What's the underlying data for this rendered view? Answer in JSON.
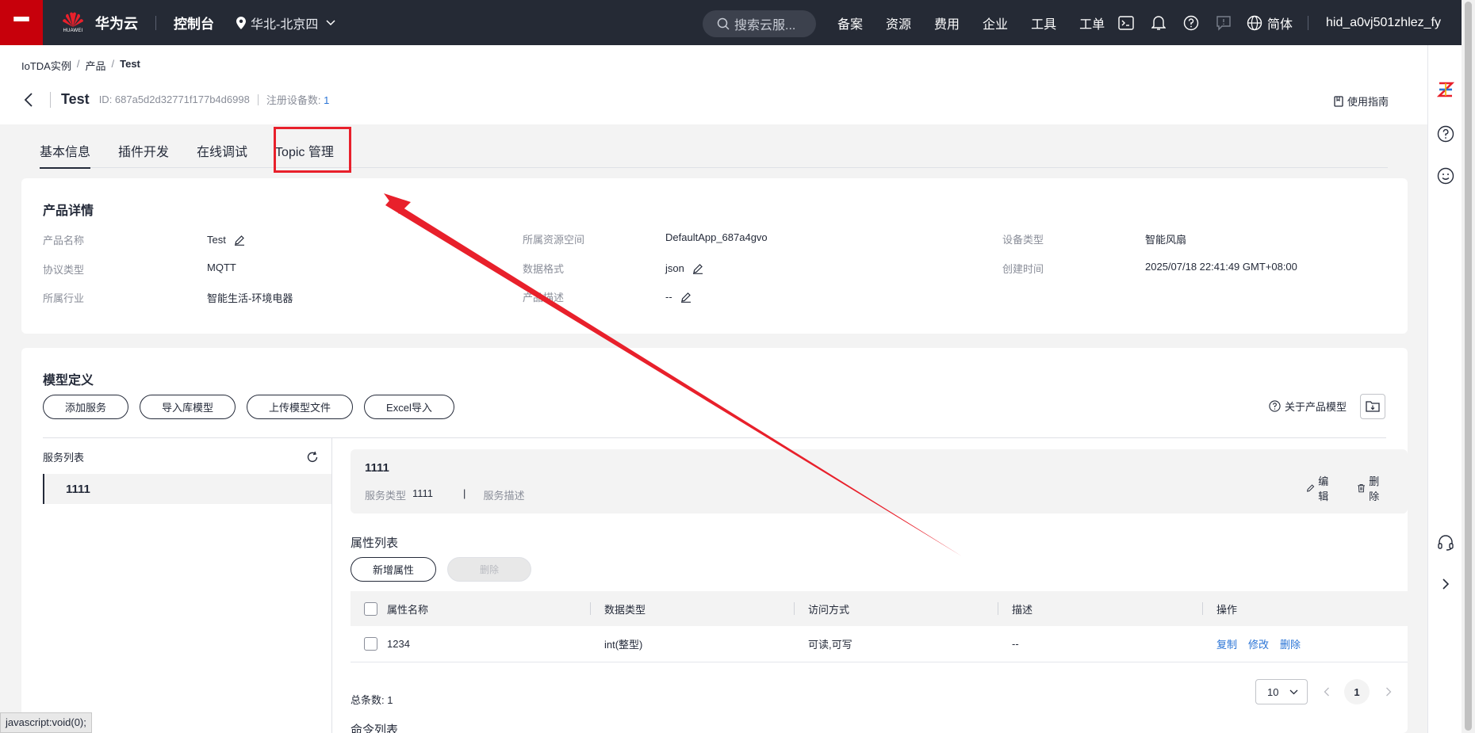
{
  "topbar": {
    "brand": "华为云",
    "brand_small": "HUAWEI",
    "console": "控制台",
    "region": "华北-北京四",
    "search_placeholder": "搜索云服...",
    "nav": [
      "备案",
      "资源",
      "费用",
      "企业",
      "工具",
      "工单"
    ],
    "lang": "简体",
    "user": "hid_a0vj501zhlez_fy"
  },
  "breadcrumb": {
    "items": [
      "IoTDA实例",
      "产品"
    ],
    "current": "Test"
  },
  "header": {
    "title": "Test",
    "id_text": "ID: 687a5d2d32771f177b4d6998",
    "reg_label": "注册设备数:",
    "reg_count": "1",
    "guide": "使用指南"
  },
  "tabs": [
    "基本信息",
    "插件开发",
    "在线调试",
    "Topic 管理"
  ],
  "details": {
    "title": "产品详情",
    "fields": [
      {
        "k": "产品名称",
        "v": "Test"
      },
      {
        "k": "协议类型",
        "v": "MQTT"
      },
      {
        "k": "所属行业",
        "v": "智能生活-环境电器"
      },
      {
        "k": "所属资源空间",
        "v": "DefaultApp_687a4gvo"
      },
      {
        "k": "数据格式",
        "v": "json"
      },
      {
        "k": "产品描述",
        "v": "--"
      },
      {
        "k": "设备类型",
        "v": "智能风扇"
      },
      {
        "k": "创建时间",
        "v": "2025/07/18 22:41:49 GMT+08:00"
      }
    ]
  },
  "model": {
    "title": "模型定义",
    "buttons": [
      "添加服务",
      "导入库模型",
      "上传模型文件",
      "Excel导入"
    ],
    "about": "关于产品模型",
    "service_list_title": "服务列表",
    "services": [
      "1111"
    ],
    "selected": {
      "name": "1111",
      "type_label": "服务类型",
      "type_value": "1111",
      "desc_label": "服务描述",
      "edit": "编辑",
      "delete": "删除"
    },
    "props": {
      "title": "属性列表",
      "add": "新增属性",
      "delete": "删除",
      "columns": [
        "属性名称",
        "数据类型",
        "访问方式",
        "描述",
        "操作"
      ],
      "rows": [
        {
          "name": "1234",
          "type": "int(整型)",
          "access": "可读,可写",
          "desc": "--",
          "actions": [
            "复制",
            "修改",
            "删除"
          ]
        }
      ],
      "total_label": "总条数:",
      "total": "1",
      "page_size": "10",
      "page": "1"
    },
    "cmd_title": "命令列表"
  },
  "status_tip": "javascript:void(0);",
  "colors": {
    "topbar": "#252a35",
    "brand_red": "#c7000b",
    "link": "#2a74d6",
    "annotation": "#e8202b"
  }
}
